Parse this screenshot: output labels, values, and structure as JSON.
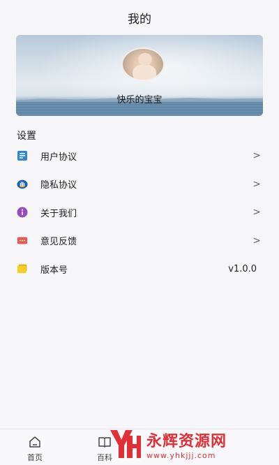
{
  "header": {
    "title": "我的"
  },
  "profile": {
    "username": "快乐的宝宝"
  },
  "settings": {
    "section_title": "设置",
    "items": [
      {
        "label": "用户协议",
        "icon": "document-icon",
        "color": "#2f86d6",
        "has_arrow": true
      },
      {
        "label": "隐私协议",
        "icon": "hand-shield-icon",
        "color": "#1f5fb0",
        "has_arrow": true
      },
      {
        "label": "关于我们",
        "icon": "info-icon",
        "color": "#9b47c8",
        "has_arrow": true
      },
      {
        "label": "意见反馈",
        "icon": "feedback-icon",
        "color": "#e05b55",
        "has_arrow": true
      },
      {
        "label": "版本号",
        "icon": "card-icon",
        "color": "#f2c21b",
        "value": "v1.0.0"
      }
    ],
    "chevron": ">"
  },
  "tabbar": {
    "tabs": [
      {
        "label": "首页",
        "icon": "home-icon"
      },
      {
        "label": "百科",
        "icon": "book-icon"
      },
      {
        "label": "",
        "icon": "community-icon"
      },
      {
        "label": "",
        "icon": "profile-icon",
        "active": true
      }
    ]
  },
  "watermark": {
    "brand": "永辉资源网",
    "url": "www.yhkjjj.com"
  }
}
